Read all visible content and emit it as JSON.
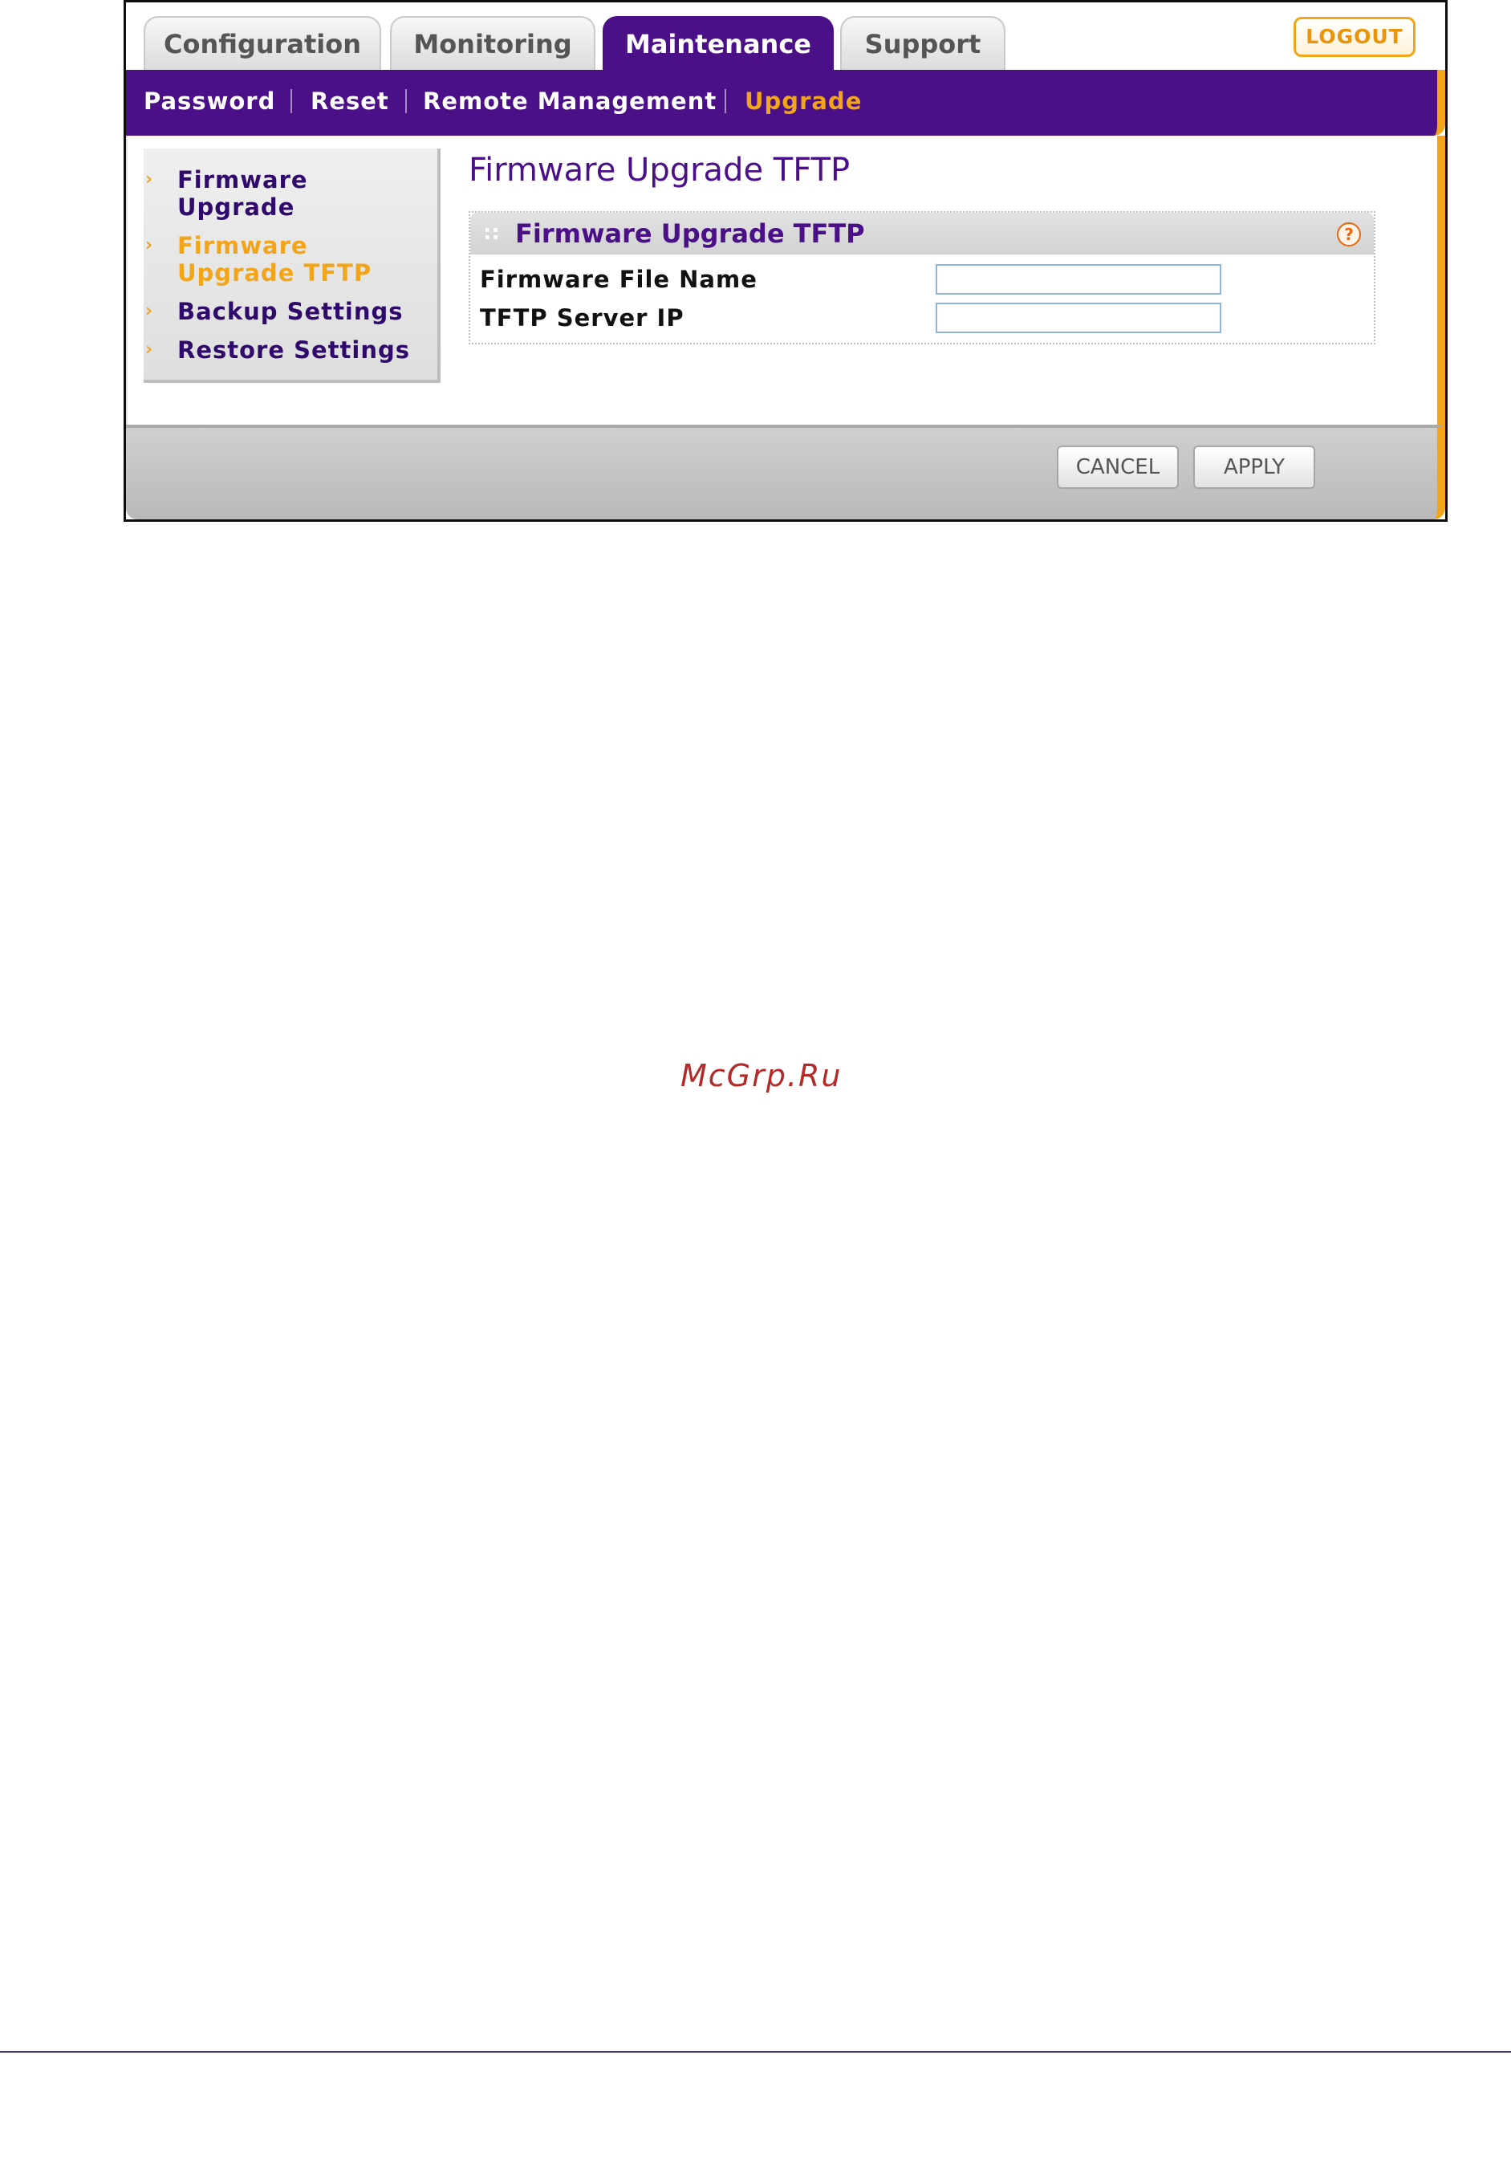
{
  "tabs": [
    {
      "label": "Configuration"
    },
    {
      "label": "Monitoring"
    },
    {
      "label": "Maintenance"
    },
    {
      "label": "Support"
    }
  ],
  "logout_label": "LOGOUT",
  "subnav": [
    {
      "label": "Password"
    },
    {
      "label": "Reset"
    },
    {
      "label": "Remote Management"
    },
    {
      "label": "Upgrade"
    }
  ],
  "sidebar": {
    "items": [
      {
        "label": "Firmware Upgrade"
      },
      {
        "label": "Firmware Upgrade TFTP"
      },
      {
        "label": "Backup Settings"
      },
      {
        "label": "Restore Settings"
      }
    ]
  },
  "page_title": "Firmware Upgrade TFTP",
  "panel": {
    "title": "Firmware Upgrade TFTP",
    "help_symbol": "?",
    "fields": [
      {
        "label": "Firmware File Name",
        "value": ""
      },
      {
        "label": "TFTP Server IP",
        "value": ""
      }
    ]
  },
  "buttons": {
    "cancel": "CANCEL",
    "apply": "APPLY"
  },
  "watermark": "McGrp.Ru",
  "colors": {
    "brand_purple": "#4b0f87",
    "accent_orange": "#f2a51a"
  }
}
